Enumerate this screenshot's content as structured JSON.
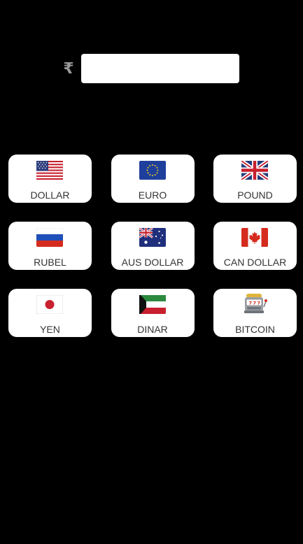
{
  "converter": {
    "currency_symbol": "₹",
    "amount_value": "",
    "amount_placeholder": ""
  },
  "currencies": [
    {
      "label": "DOLLAR",
      "icon": "us-flag-icon"
    },
    {
      "label": "EURO",
      "icon": "eu-flag-icon"
    },
    {
      "label": "POUND",
      "icon": "uk-flag-icon"
    },
    {
      "label": "RUBEL",
      "icon": "russia-flag-icon"
    },
    {
      "label": "AUS DOLLAR",
      "icon": "australia-flag-icon"
    },
    {
      "label": "CAN DOLLAR",
      "icon": "canada-flag-icon"
    },
    {
      "label": "YEN",
      "icon": "japan-flag-icon"
    },
    {
      "label": "DINAR",
      "icon": "kuwait-flag-icon"
    },
    {
      "label": "BITCOIN",
      "icon": "slot-machine-icon"
    }
  ]
}
